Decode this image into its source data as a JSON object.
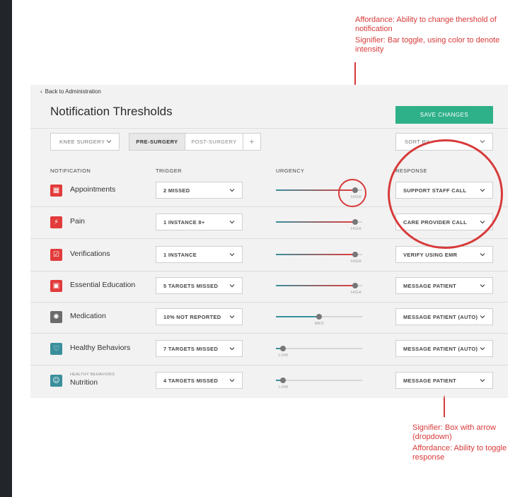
{
  "annotations": {
    "top_affordance": "Affordance: Ability to change thershold of notification",
    "top_signifier": "Signifier: Bar toggle, using color to denote intensity",
    "bottom_signifier": "Signifier: Box with arrow (dropdown)",
    "bottom_affordance": "Affordance: Ability to toggle response"
  },
  "header": {
    "back_label": "Back to Administration",
    "title": "Notification Thresholds",
    "save_label": "SAVE CHANGES"
  },
  "filters": {
    "surgery": "KNEE SURGERY",
    "tabs": [
      "PRE-SURGERY",
      "POST-SURGERY",
      "+"
    ],
    "active_tab": "PRE-SURGERY",
    "sort_label": "SORT BY"
  },
  "columns": {
    "notification": "NOTIFICATION",
    "trigger": "TRIGGER",
    "urgency": "URGENCY",
    "response": "RESPONSE"
  },
  "colors": {
    "accent_green": "#2eb088",
    "alert_red": "#e23b3b",
    "teal": "#3b8f9c",
    "gray": "#6b6b6b",
    "annotation_red": "#d83a3a"
  },
  "rows": [
    {
      "name": "Appointments",
      "sub": "",
      "icon": "calendar-icon",
      "trigger": "2 MISSED",
      "urgency": "HIGH",
      "urgency_fraction": 0.92,
      "response": "SUPPORT STAFF CALL"
    },
    {
      "name": "Pain",
      "sub": "",
      "icon": "lightning-icon",
      "trigger": "1 INSTANCE  8+",
      "urgency": "HIGH",
      "urgency_fraction": 0.92,
      "response": "CARE PROVIDER CALL"
    },
    {
      "name": "Verifications",
      "sub": "",
      "icon": "check-box-icon",
      "trigger": "1 INSTANCE",
      "urgency": "HIGH",
      "urgency_fraction": 0.92,
      "response": "VERIFY USING EMR"
    },
    {
      "name": "Essential Education",
      "sub": "",
      "icon": "book-icon",
      "trigger": "5 TARGETS MISSED",
      "urgency": "HIGH",
      "urgency_fraction": 0.92,
      "response": "MESSAGE PATIENT"
    },
    {
      "name": "Medication",
      "sub": "",
      "icon": "pill-icon",
      "trigger": "10% NOT REPORTED",
      "urgency": "MED",
      "urgency_fraction": 0.5,
      "response": "MESSAGE PATIENT (AUTO)"
    },
    {
      "name": "Healthy Behaviors",
      "sub": "",
      "icon": "heart-icon",
      "trigger": "7 TARGETS MISSED",
      "urgency": "LOW",
      "urgency_fraction": 0.08,
      "response": "MESSAGE PATIENT (AUTO)"
    },
    {
      "name": "Nutrition",
      "sub": "HEALTHY BEHAVIORS",
      "icon": "apple-icon",
      "trigger": "4 TARGETS MISSED",
      "urgency": "LOW",
      "urgency_fraction": 0.08,
      "response": "MESSAGE PATIENT"
    }
  ]
}
